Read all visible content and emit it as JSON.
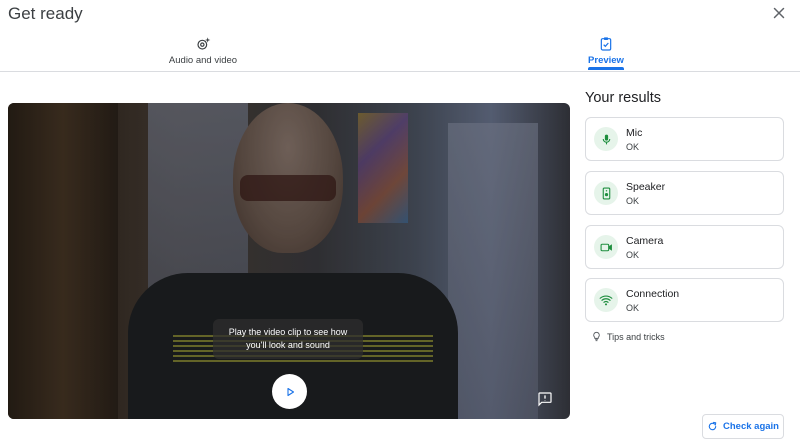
{
  "dialog": {
    "title": "Get ready",
    "close_icon": "close-icon"
  },
  "tabs": [
    {
      "label": "Audio and video",
      "icon": "sparkle-settings-icon",
      "active": false
    },
    {
      "label": "Preview",
      "icon": "clipboard-check-icon",
      "active": true
    }
  ],
  "preview": {
    "hint_line1": "Play the video clip to see how",
    "hint_line2": "you'll look and sound",
    "play_icon": "play-icon",
    "feedback_icon": "feedback-icon"
  },
  "results": {
    "title": "Your results",
    "items": [
      {
        "name": "Mic",
        "status": "OK",
        "icon": "mic-icon"
      },
      {
        "name": "Speaker",
        "status": "OK",
        "icon": "speaker-icon"
      },
      {
        "name": "Camera",
        "status": "OK",
        "icon": "camera-icon"
      },
      {
        "name": "Connection",
        "status": "OK",
        "icon": "wifi-icon"
      }
    ],
    "tips_label": "Tips and tricks",
    "check_again_label": "Check again"
  },
  "colors": {
    "accent": "#1a73e8",
    "ok_green": "#1e8e3e",
    "ok_bg": "#e6f4ea"
  }
}
